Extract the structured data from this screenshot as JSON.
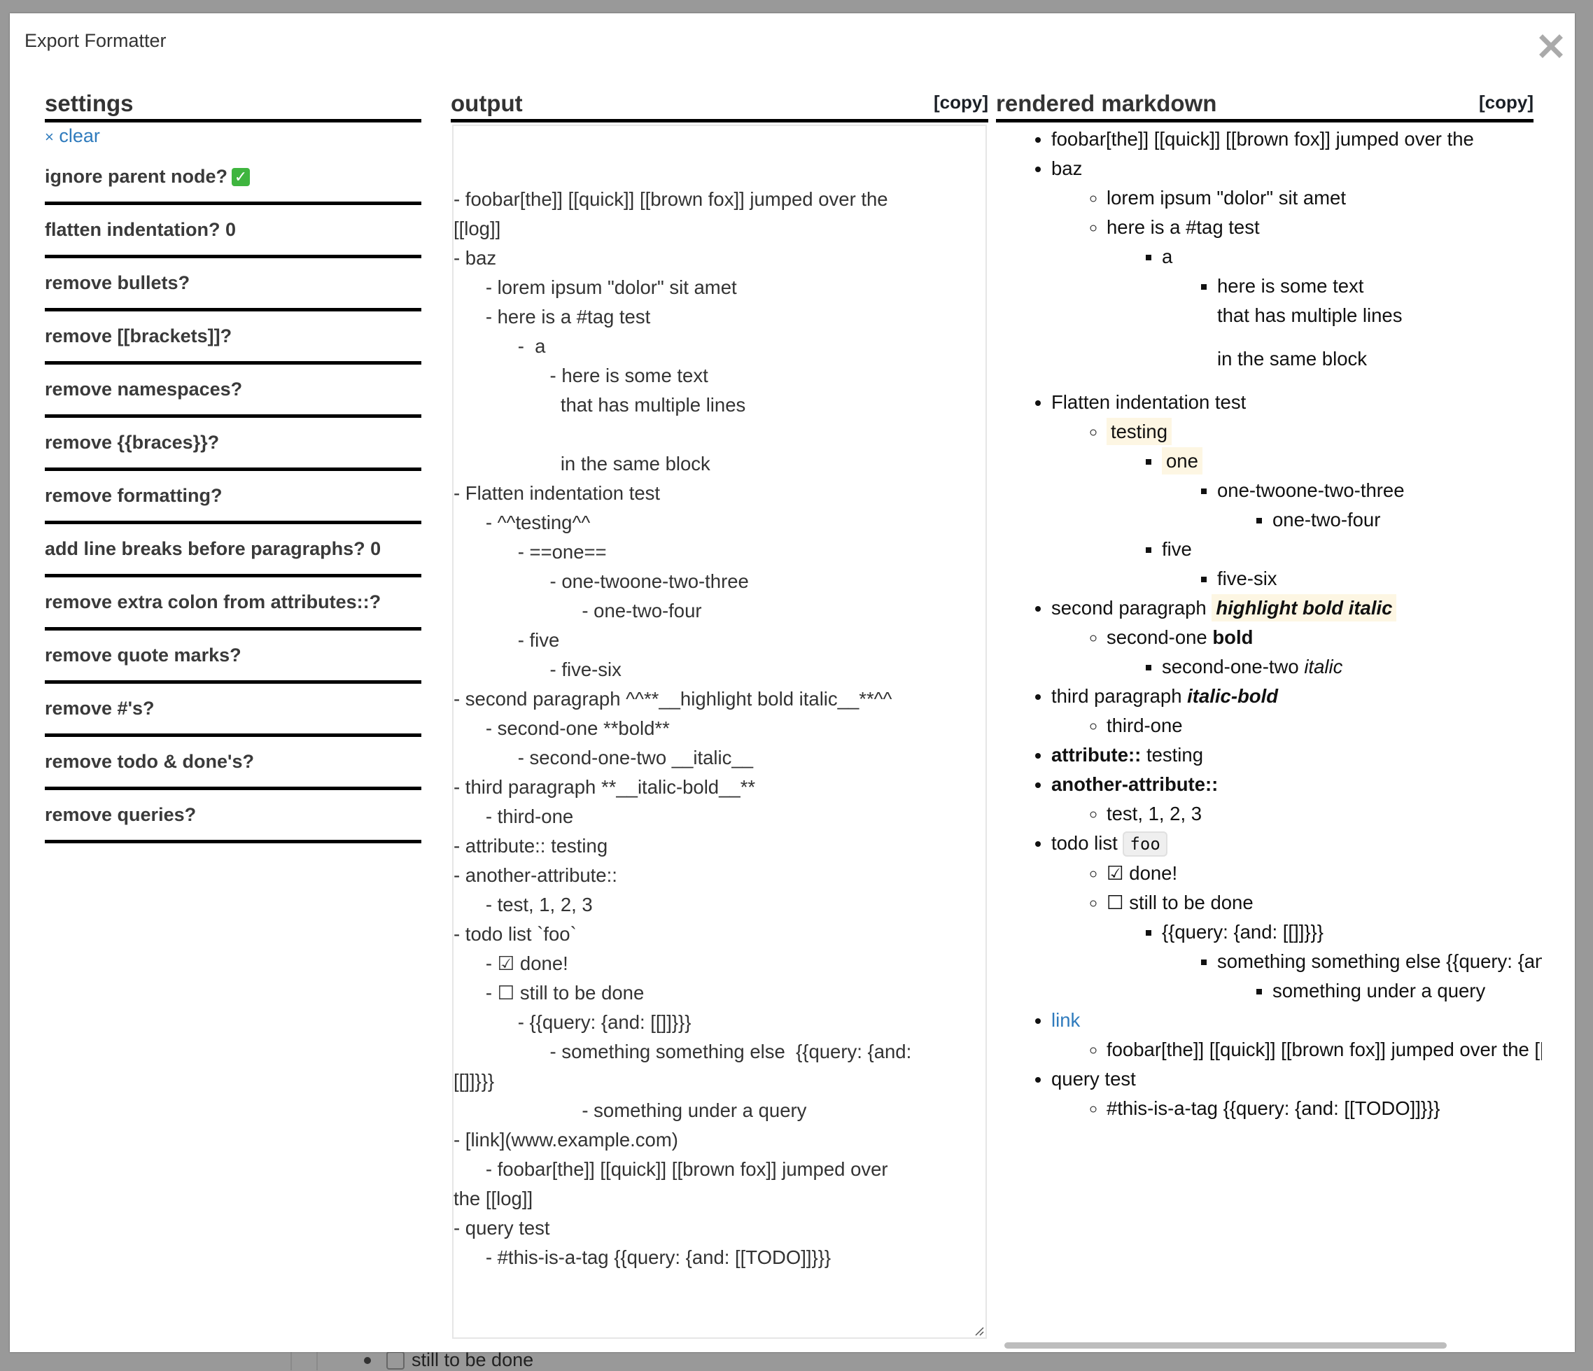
{
  "background": {
    "todo_fragment": "still to be done"
  },
  "modal": {
    "title": "Export Formatter",
    "close_icon": "close-icon"
  },
  "settings": {
    "header": "settings",
    "clear_label": "clear",
    "clear_icon": "×",
    "items": [
      {
        "label": "ignore parent node?",
        "value": "✓",
        "checked": true
      },
      {
        "label": "flatten indentation? 0"
      },
      {
        "label": "remove bullets?"
      },
      {
        "label": "remove [[brackets]]?"
      },
      {
        "label": "remove namespaces?"
      },
      {
        "label": "remove {{braces}}?"
      },
      {
        "label": "remove formatting?"
      },
      {
        "label": "add line breaks before paragraphs? 0"
      },
      {
        "label": "remove extra colon from attributes::?"
      },
      {
        "label": "remove quote marks?"
      },
      {
        "label": "remove #'s?"
      },
      {
        "label": "remove todo & done's?"
      },
      {
        "label": "remove queries?"
      }
    ]
  },
  "output": {
    "header": "output",
    "copy_label": "[copy]",
    "lines": [
      "- foobar[the]] [[quick]] [[brown fox]] jumped over the",
      "[[log]]",
      "- baz",
      "      - lorem ipsum \"dolor\" sit amet",
      "      - here is a #tag test",
      "            -  a",
      "                  - here is some text",
      "                    that has multiple lines",
      "",
      "                    in the same block",
      "- Flatten indentation test",
      "      - ^^testing^^",
      "            - ==one==",
      "                  - one-twoone-two-three",
      "                        - one-two-four",
      "            - five",
      "                  - five-six",
      "- second paragraph ^^**__highlight bold italic__**^^",
      "      - second-one **bold**",
      "            - second-one-two __italic__",
      "- third paragraph **__italic-bold__**",
      "      - third-one",
      "- attribute:: testing",
      "- another-attribute::",
      "      - test, 1, 2, 3",
      "- todo list `foo`",
      "      - ☑ done!",
      "      - ☐ still to be done",
      "            - {{query: {and: [[]]}}}",
      "                  - something something else  {{query: {and:",
      "[[]]}}}",
      "                        - something under a query",
      "- [link](www.example.com)",
      "      - foobar[the]] [[quick]] [[brown fox]] jumped over",
      "the [[log]]",
      "- query test",
      "      - #this-is-a-tag {{query: {and: [[TODO]]}}}"
    ]
  },
  "rendered": {
    "header": "rendered markdown",
    "copy_label": "[copy]",
    "item_foobar": "foobar[the]] [[quick]] [[brown fox]] jumped over the",
    "item_baz": "baz",
    "item_lorem": "lorem ipsum \"dolor\" sit amet",
    "item_tag": "here is a #tag test",
    "item_a": "a",
    "item_multi_1": "here is some text",
    "item_multi_2": "that has multiple lines",
    "item_multi_3": "in the same block",
    "item_flatten": "Flatten indentation test",
    "item_testing": "testing",
    "item_one": "one",
    "item_one_two_three": "one-twoone-two-three",
    "item_one_two_four": "one-two-four",
    "item_five": "five",
    "item_five_six": "five-six",
    "item_second_prefix": "second paragraph",
    "item_second_hl": "highlight bold italic",
    "item_second_one_prefix": "second-one",
    "item_second_one_bold": "bold",
    "item_second_one_two_prefix": "second-one-two",
    "item_second_one_two_italic": "italic",
    "item_third_prefix": "third paragraph",
    "item_third_bi": "italic-bold",
    "item_third_one": "third-one",
    "item_attr_key": "attribute::",
    "item_attr_val": "testing",
    "item_another_attr": "another-attribute::",
    "item_test123": "test, 1, 2, 3",
    "item_todo_prefix": "todo list",
    "item_todo_code": "foo",
    "item_done": "☑ done!",
    "item_still": "☐ still to be done",
    "item_query1": "{{query: {and: [[]]}}}",
    "item_something": "something something else {{query: {and: [[]]}}}",
    "item_under_query": "something under a query",
    "item_link": "link",
    "item_link_child": "foobar[the]] [[quick]] [[brown fox]] jumped over the [[log]]",
    "item_query_test": "query test",
    "item_this_tag": "#this-is-a-tag {{query: {and: [[TODO]]}}}"
  },
  "colors": {
    "link": "#2f7bbd",
    "highlight": "#fdf6e3",
    "backdrop": "#999999"
  }
}
